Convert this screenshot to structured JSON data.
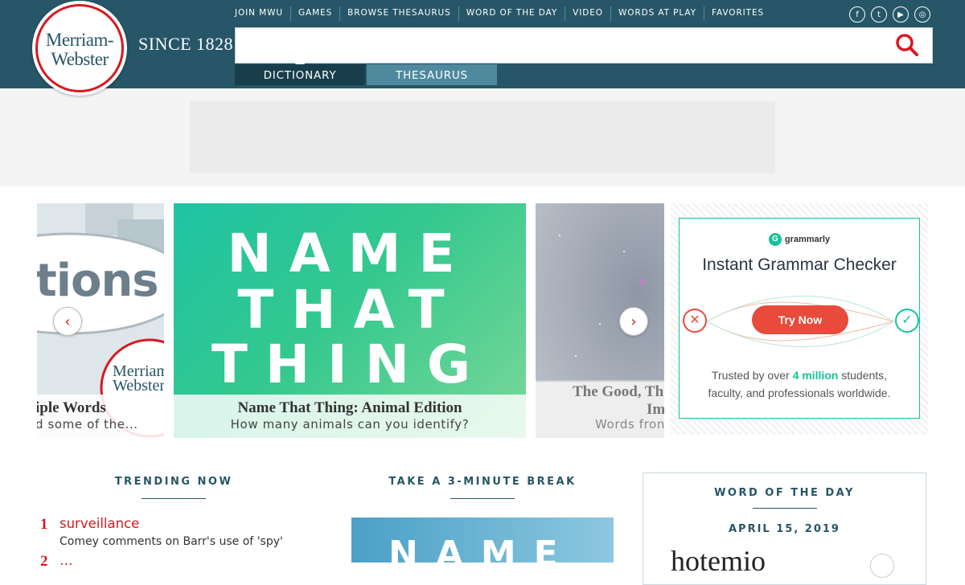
{
  "brand": {
    "logo_line1": "Merriam-",
    "logo_line2": "Webster",
    "since": "SINCE 1828"
  },
  "topnav": [
    "JOIN MWU",
    "GAMES",
    "BROWSE THESAURUS",
    "WORD OF THE DAY",
    "VIDEO",
    "WORDS AT PLAY",
    "FAVORITES"
  ],
  "social": {
    "facebook": "f",
    "twitter": "t",
    "youtube": "▶",
    "instagram": "◎"
  },
  "search": {
    "value": "",
    "placeholder": ""
  },
  "tabs": {
    "dictionary": "DICTIONARY",
    "thesaurus": "THESAURUS"
  },
  "carousel": {
    "left": {
      "image_text": "tions",
      "watermark_1": "Merriam",
      "watermark_2": "Webster",
      "title": "iple Words",
      "subtitle": "d some of the..."
    },
    "main": {
      "line1": "NAME",
      "line2": "THAT",
      "line3": "THING",
      "title": "Name That Thing: Animal Edition",
      "subtitle": "How many animals can you identify?"
    },
    "right": {
      "title": "The Good, Th",
      "title2": "Im",
      "subtitle": "Words fron"
    },
    "prev": "‹",
    "next": "›"
  },
  "ad": {
    "brand": "grammarly",
    "brand_glyph": "G",
    "title": "Instant Grammar Checker",
    "button": "Try Now",
    "text_before": "Trusted by over ",
    "text_bold": "4 million",
    "text_after": " students,",
    "text_line2": "faculty, and professionals worldwide.",
    "x_glyph": "✕",
    "check_glyph": "✓"
  },
  "sections": {
    "trending": "TRENDING NOW",
    "break": "TAKE A 3-MINUTE BREAK",
    "wotd": "WORD OF THE DAY"
  },
  "trending": [
    {
      "num": "1",
      "word": "surveillance",
      "desc": "Comey comments on Barr's use of 'spy'"
    },
    {
      "num": "2",
      "word": "…"
    }
  ],
  "break_image": "NAME",
  "wotd": {
    "date": "APRIL 15, 2019",
    "word": "hotemio"
  },
  "colors": {
    "header": "#265667",
    "accent": "#d71920",
    "grammarly": "#15c39a"
  }
}
